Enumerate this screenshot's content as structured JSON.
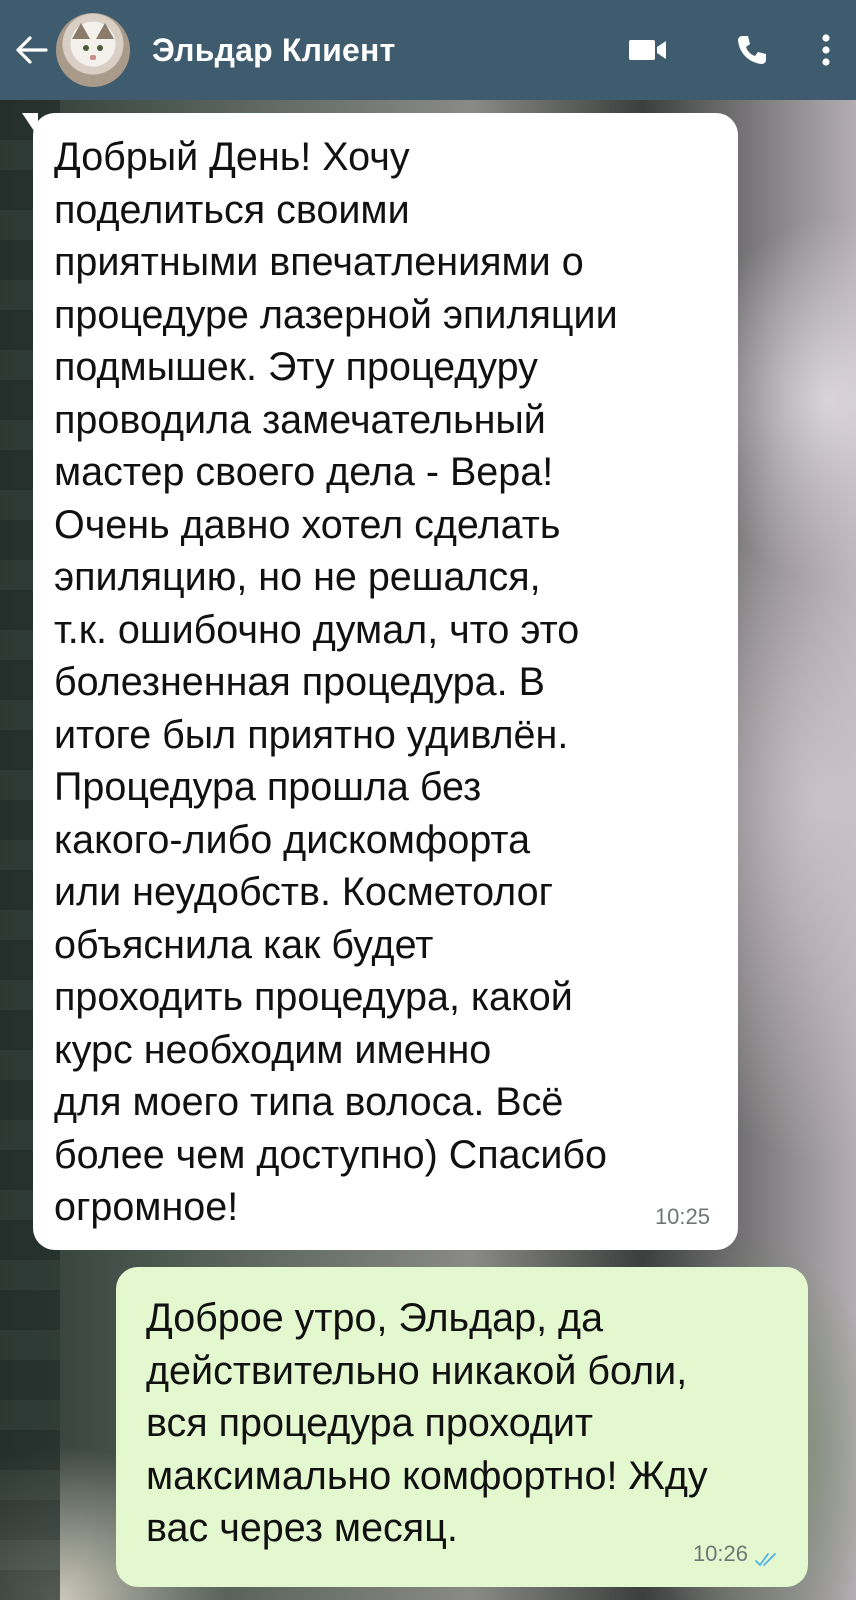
{
  "header": {
    "contact_name": "Эльдар Клиент",
    "back_icon": "arrow-left-icon",
    "avatar": "cat-avatar",
    "video_call_icon": "video-camera-icon",
    "voice_call_icon": "phone-icon",
    "menu_icon": "more-vert-icon",
    "bar_color": "#3f5c6e"
  },
  "messages": [
    {
      "direction": "incoming",
      "text": "Добрый День! Хочу\nподелиться своими\nприятными впечатлениями о\nпроцедуре лазерной эпиляции\nподмышек. Эту процедуру\nпроводила замечательный\nмастер своего дела - Вера!\nОчень давно хотел сделать\nэпиляцию, но не решался,\nт.к. ошибочно думал, что это\nболезненная процедура. В\nитоге был приятно удивлён.\nПроцедура прошла без\nкакого-либо дискомфорта\nили неудобств. Косметолог\nобъяснила как будет\nпроходить процедура, какой\nкурс необходим именно\nдля моего типа волоса. Всё\nболее чем доступно) Спасибо\nогромное!",
      "time": "10:25",
      "bubble_color": "#ffffff"
    },
    {
      "direction": "outgoing",
      "text": "Доброе утро, Эльдар, да\nдействительно никакой боли,\nвся процедура проходит\nмаксимально комфортно! Жду\nвас через месяц.",
      "time": "10:26",
      "status": "read",
      "status_icon": "double-check-icon",
      "bubble_color": "#e4f8d0",
      "tick_color": "#4fb3e8"
    }
  ]
}
